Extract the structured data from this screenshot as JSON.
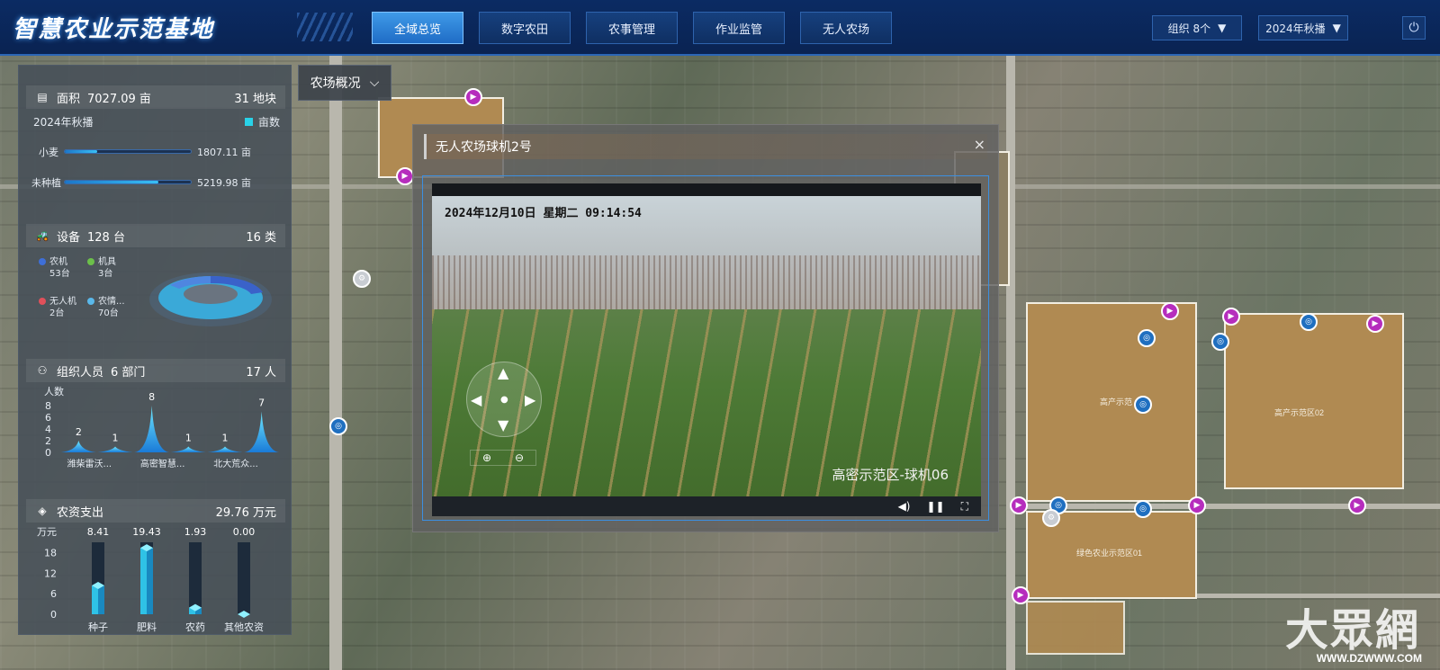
{
  "header": {
    "title": "智慧农业示范基地",
    "tabs": [
      {
        "label": "全域总览",
        "active": true
      },
      {
        "label": "数字农田",
        "active": false
      },
      {
        "label": "农事管理",
        "active": false
      },
      {
        "label": "作业监管",
        "active": false
      },
      {
        "label": "无人农场",
        "active": false
      }
    ],
    "org_select": "组织 8个",
    "season_select": "2024年秋播",
    "power_icon": "power-icon"
  },
  "area": {
    "label": "面积",
    "value": "7027.09 亩",
    "blocks": "31 地块",
    "season": "2024年秋播",
    "legend": "亩数",
    "rows": [
      {
        "name": "小麦",
        "value": "1807.11 亩",
        "ratio": 0.26
      },
      {
        "name": "未种植",
        "value": "5219.98 亩",
        "ratio": 0.74
      }
    ]
  },
  "equipment": {
    "label": "设备",
    "value": "128 台",
    "types": "16 类",
    "items": [
      {
        "name": "农机",
        "count": "53台",
        "color": "#3e6fd8"
      },
      {
        "name": "机具",
        "count": "3台",
        "color": "#6cc04a"
      },
      {
        "name": "无人机",
        "count": "2台",
        "color": "#e0505a"
      },
      {
        "name": "农情...",
        "count": "70台",
        "color": "#5ab8ea"
      }
    ]
  },
  "staff": {
    "label": "组织人员",
    "value": "6 部门",
    "total": "17 人",
    "chart_data": {
      "type": "area",
      "ylabel": "人数",
      "yticks": [
        0,
        2,
        4,
        6,
        8
      ],
      "ylim": [
        0,
        8
      ],
      "categories": [
        "潍柴雷沃...",
        "",
        "高密智慧...",
        "",
        "北大荒众...",
        ""
      ],
      "values": [
        2,
        1,
        8,
        1,
        1,
        7
      ]
    }
  },
  "costs": {
    "label": "农资支出",
    "total": "29.76 万元",
    "chart_data": {
      "type": "bar",
      "ylabel": "万元",
      "yticks": [
        0,
        6,
        12,
        18
      ],
      "ylim": [
        0,
        20
      ],
      "categories": [
        "种子",
        "肥料",
        "农药",
        "其他农资"
      ],
      "values": [
        8.41,
        19.43,
        1.93,
        0.0
      ],
      "value_labels": [
        "8.41",
        "19.43",
        "1.93",
        "0.00"
      ]
    }
  },
  "overview_button": "农场概况",
  "modal": {
    "title": "无人农场球机2号",
    "close": "×",
    "osd_datetime": "2024年12月10日 星期二 09:14:54",
    "osd_camera": "高密示范区-球机06"
  },
  "map_labels": {
    "zone_a": "高产示范",
    "zone_b": "高产示范区02",
    "zone_c": "绿色农业示范区01"
  },
  "watermark": {
    "text": "大眾網",
    "url": "WWW.DZWWW.COM"
  }
}
